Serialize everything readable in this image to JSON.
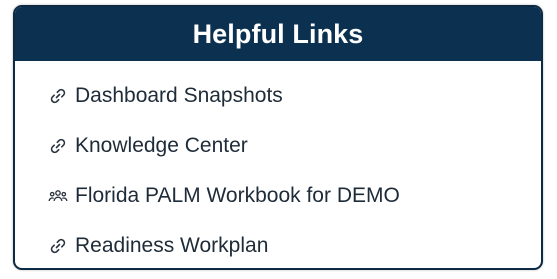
{
  "panel": {
    "title": "Helpful Links",
    "colors": {
      "header_bg": "#0c3150",
      "header_text": "#ffffff",
      "border": "#0d2a44",
      "link_text": "#1e2b38"
    },
    "links": [
      {
        "label": "Dashboard Snapshots",
        "icon": "link-icon"
      },
      {
        "label": "Knowledge Center",
        "icon": "link-icon"
      },
      {
        "label": "Florida PALM Workbook for DEMO",
        "icon": "people-icon"
      },
      {
        "label": "Readiness Workplan",
        "icon": "link-icon"
      }
    ]
  }
}
